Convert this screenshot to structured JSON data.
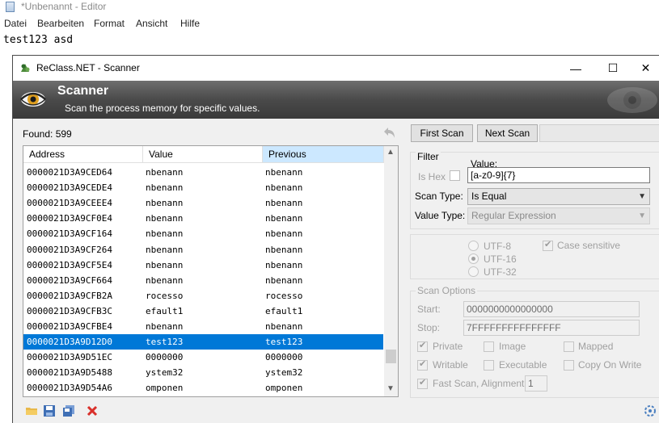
{
  "notepad": {
    "title": "*Unbenannt - Editor",
    "menu": [
      "Datei",
      "Bearbeiten",
      "Format",
      "Ansicht",
      "Hilfe"
    ],
    "content": "test123 asd"
  },
  "window": {
    "title": "ReClass.NET - Scanner",
    "minimize": "—",
    "maximize": "☐",
    "close": "✕"
  },
  "banner": {
    "title": "Scanner",
    "subtitle": "Scan the process memory for specific values."
  },
  "results": {
    "found_label": "Found: 599",
    "columns": [
      "Address",
      "Value",
      "Previous"
    ],
    "rows": [
      {
        "address": "0000021D3A9CED64",
        "value": "nbenann",
        "previous": "nbenann"
      },
      {
        "address": "0000021D3A9CEDE4",
        "value": "nbenann",
        "previous": "nbenann"
      },
      {
        "address": "0000021D3A9CEEE4",
        "value": "nbenann",
        "previous": "nbenann"
      },
      {
        "address": "0000021D3A9CF0E4",
        "value": "nbenann",
        "previous": "nbenann"
      },
      {
        "address": "0000021D3A9CF164",
        "value": "nbenann",
        "previous": "nbenann"
      },
      {
        "address": "0000021D3A9CF264",
        "value": "nbenann",
        "previous": "nbenann"
      },
      {
        "address": "0000021D3A9CF5E4",
        "value": "nbenann",
        "previous": "nbenann"
      },
      {
        "address": "0000021D3A9CF664",
        "value": "nbenann",
        "previous": "nbenann"
      },
      {
        "address": "0000021D3A9CFB2A",
        "value": "rocesso",
        "previous": "rocesso"
      },
      {
        "address": "0000021D3A9CFB3C",
        "value": "efault1",
        "previous": "efault1"
      },
      {
        "address": "0000021D3A9CFBE4",
        "value": "nbenann",
        "previous": "nbenann"
      },
      {
        "address": "0000021D3A9D12D0",
        "value": "test123",
        "previous": "test123"
      },
      {
        "address": "0000021D3A9D51EC",
        "value": "0000000",
        "previous": "0000000"
      },
      {
        "address": "0000021D3A9D5488",
        "value": "ystem32",
        "previous": "ystem32"
      },
      {
        "address": "0000021D3A9D54A6",
        "value": "omponen",
        "previous": "omponen"
      }
    ],
    "selected_index": 11
  },
  "buttons": {
    "first_scan": "First Scan",
    "next_scan": "Next Scan"
  },
  "filter": {
    "group_label": "Filter",
    "value_label": "Value:",
    "value": "[a-z0-9]{7}",
    "is_hex_label": "Is Hex",
    "scan_type_label": "Scan Type:",
    "scan_type": "Is Equal",
    "value_type_label": "Value Type:",
    "value_type": "Regular Expression"
  },
  "encoding": {
    "options": [
      "UTF-8",
      "UTF-16",
      "UTF-32"
    ],
    "selected": "UTF-16",
    "case_sensitive_label": "Case sensitive",
    "case_sensitive": true
  },
  "scan_options": {
    "group_label": "Scan Options",
    "start_label": "Start:",
    "start": "0000000000000000",
    "stop_label": "Stop:",
    "stop": "7FFFFFFFFFFFFFFF",
    "private_label": "Private",
    "private": true,
    "image_label": "Image",
    "image": false,
    "mapped_label": "Mapped",
    "mapped": false,
    "writable_label": "Writable",
    "writable": true,
    "executable_label": "Executable",
    "executable": false,
    "copy_on_write_label": "Copy On Write",
    "copy_on_write": false,
    "fast_scan_label": "Fast Scan, Alignment:",
    "fast_scan": true,
    "alignment": "1"
  },
  "colors": {
    "selection": "#0078d7",
    "sorted_header": "#cce8ff",
    "banner_dark": "#3a3a3a"
  },
  "icons": [
    "open-folder-icon",
    "save-icon",
    "save-as-icon",
    "clear-icon",
    "undo-icon",
    "settings-icon"
  ]
}
